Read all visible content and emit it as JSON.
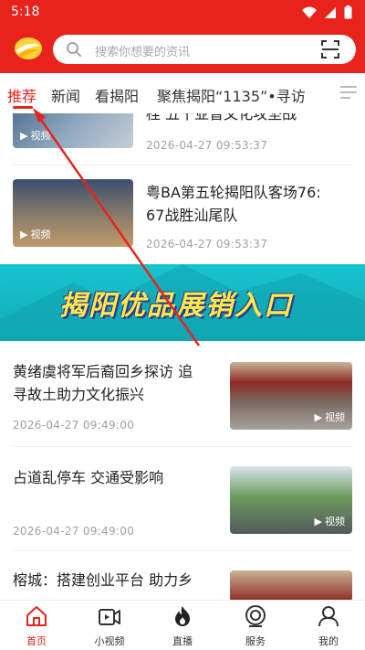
{
  "status": {
    "time": "5:18"
  },
  "search": {
    "placeholder": "搜索你想要的资讯"
  },
  "tabs": [
    {
      "label": "推荐",
      "active": true
    },
    {
      "label": "新闻"
    },
    {
      "label": "看揭阳"
    },
    {
      "label": "聚焦揭阳“1135”•寻访"
    }
  ],
  "feed": {
    "items": [
      {
        "title": "桂  五千亚普文化攻坚战",
        "time": "2026-04-27 09:53:37",
        "thumb_label": "视频"
      },
      {
        "title": "粤BA第五轮揭阳队客场76:67战胜汕尾队",
        "title_line1": "粤BA第五轮揭阳队客场76:",
        "title_line2": "67战胜汕尾队",
        "time": "2026-04-27 09:53:37",
        "thumb_label": "视频"
      },
      {
        "title_line1": "黄绪虞将军后裔回乡探访 追",
        "title_line2": "寻故土助力文化振兴",
        "time": "2026-04-27 09:49:00",
        "thumb_label": "视频"
      },
      {
        "title_line1": "占道乱停车  交通受影响",
        "time": "2026-04-27 09:49:00",
        "thumb_label": "视频"
      },
      {
        "title_line1": "榕城：搭建创业平台  助力乡"
      }
    ],
    "banner": {
      "text": "揭阳优品展销入口"
    }
  },
  "nav": [
    {
      "label": "首页",
      "icon": "home-icon",
      "active": true
    },
    {
      "label": "小视频",
      "icon": "video-icon"
    },
    {
      "label": "直播",
      "icon": "fire-icon"
    },
    {
      "label": "服务",
      "icon": "service-icon"
    },
    {
      "label": "我的",
      "icon": "profile-icon"
    }
  ],
  "colors": {
    "brand": "#e8231b",
    "banner": "#17c4cf",
    "banner_text": "#ffe84a"
  }
}
